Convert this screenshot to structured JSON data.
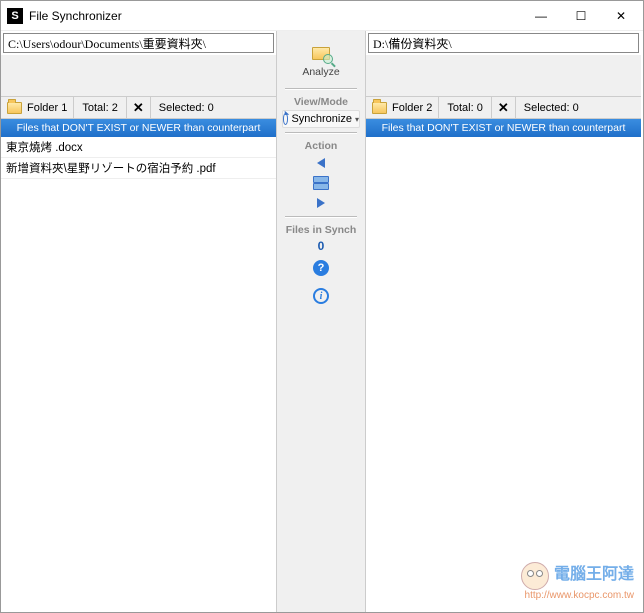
{
  "window": {
    "title": "File Synchronizer",
    "min": "—",
    "max": "☐",
    "close": "✕"
  },
  "left": {
    "path": "C:\\Users\\odour\\Documents\\重要資料夾\\",
    "folder_label": "Folder 1",
    "total_label": "Total: 2",
    "selected_label": "Selected: 0",
    "banner": "Files that DON'T EXIST or NEWER than counterpart",
    "files": [
      "東京燒烤 .docx",
      "新增資料夾\\星野リゾートの宿泊予約 .pdf"
    ]
  },
  "right": {
    "path": "D:\\備份資料夾\\",
    "folder_label": "Folder 2",
    "total_label": "Total: 0",
    "selected_label": "Selected: 0",
    "banner": "Files that DON'T EXIST or NEWER than counterpart",
    "files": []
  },
  "middle": {
    "analyze": "Analyze",
    "view_mode_label": "View/Mode",
    "synchronize": "Synchronize",
    "action_label": "Action",
    "files_in_synch_label": "Files in Synch",
    "files_in_synch_count": "0"
  },
  "watermark": {
    "text": "電腦王阿達",
    "url": "http://www.kocpc.com.tw"
  }
}
